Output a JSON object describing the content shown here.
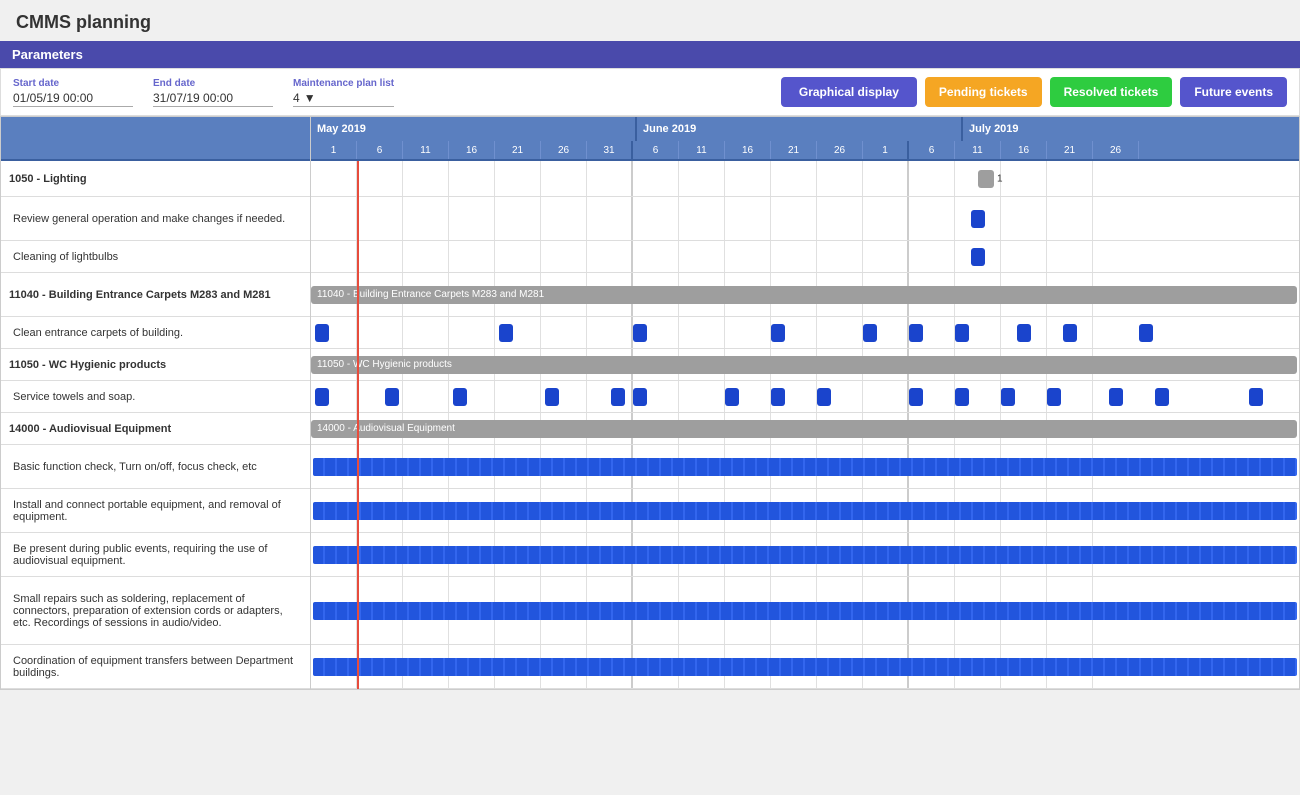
{
  "page": {
    "title": "CMMS planning"
  },
  "parameters": {
    "label": "Parameters"
  },
  "controls": {
    "start_date_label": "Start date",
    "start_date_value": "01/05/19 00:00",
    "end_date_label": "End date",
    "end_date_value": "31/07/19 00:00",
    "maintenance_label": "Maintenance plan list",
    "maintenance_value": "4"
  },
  "buttons": {
    "graphical": "Graphical display",
    "pending": "Pending tickets",
    "resolved": "Resolved tickets",
    "future": "Future events"
  },
  "months": [
    {
      "label": "May 2019",
      "cols": 13
    },
    {
      "label": "June 2019",
      "cols": 13
    },
    {
      "label": "July 2019",
      "cols": 13
    }
  ],
  "days": [
    1,
    6,
    11,
    16,
    21,
    26,
    31,
    6,
    11,
    16,
    21,
    26,
    1,
    6,
    11,
    16,
    21,
    26
  ],
  "tasks": [
    {
      "id": "g1",
      "name": "1050 - Lighting",
      "type": "group",
      "bold": true
    },
    {
      "id": "t1",
      "name": "Review general operation and make changes if needed.",
      "type": "sub"
    },
    {
      "id": "t2",
      "name": "Cleaning of lightbulbs",
      "type": "sub"
    },
    {
      "id": "g2",
      "name": "11040 - Building Entrance Carpets M283 and M281",
      "type": "group",
      "bold": true
    },
    {
      "id": "t3",
      "name": "Clean entrance carpets of building.",
      "type": "sub"
    },
    {
      "id": "g3",
      "name": "11050 - WC Hygienic products",
      "type": "group",
      "bold": true
    },
    {
      "id": "t4",
      "name": "Service towels and soap.",
      "type": "sub"
    },
    {
      "id": "g4",
      "name": "14000 - Audiovisual Equipment",
      "type": "group",
      "bold": true
    },
    {
      "id": "t5",
      "name": "Basic function check, Turn on/off, focus check, etc",
      "type": "sub"
    },
    {
      "id": "t6",
      "name": "Install and connect portable equipment, and removal of equipment.",
      "type": "sub"
    },
    {
      "id": "t7",
      "name": "Be present during public events, requiring the use of audiovisual equipment.",
      "type": "sub"
    },
    {
      "id": "t8",
      "name": "Small repairs such as soldering, replacement of connectors, preparation of extension cords or adapters, etc. Recordings of sessions in audio/video.",
      "type": "sub",
      "tall": true
    },
    {
      "id": "t9",
      "name": "Coordination of equipment transfers between Department buildings.",
      "type": "sub"
    }
  ]
}
